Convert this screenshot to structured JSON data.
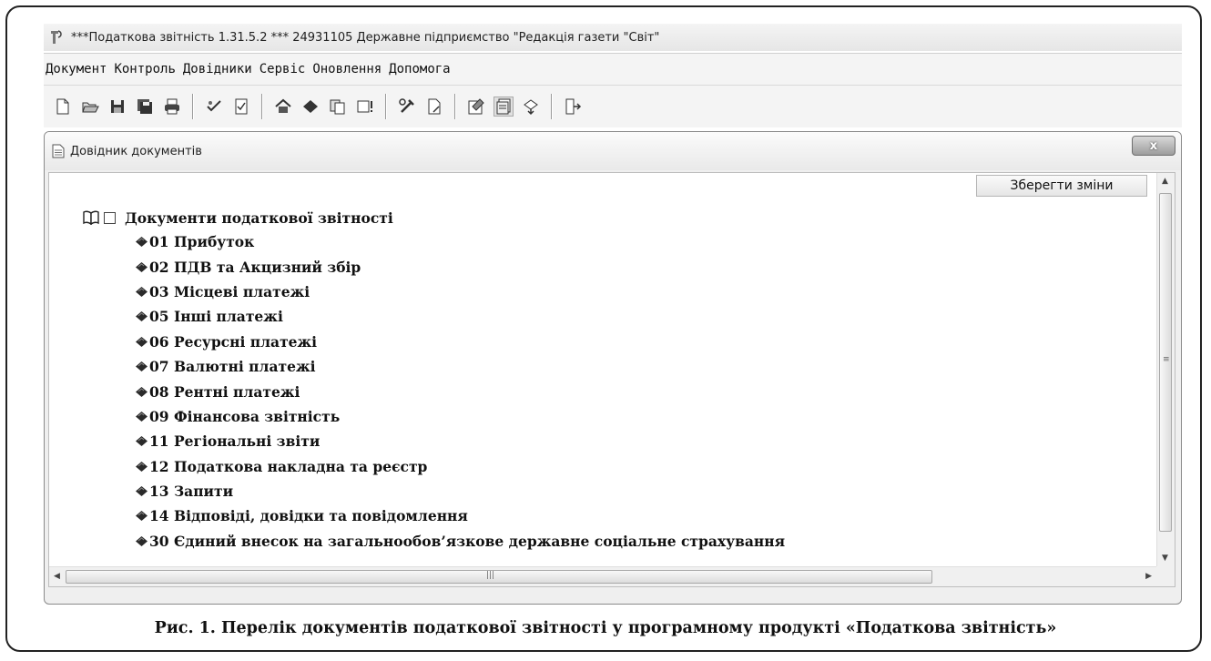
{
  "window": {
    "title": "***Податкова звітність 1.31.5.2 *** 24931105 Державне підприємство \"Редакція газети \"Світ\""
  },
  "menu": [
    "Документ",
    "Контроль",
    "Довідники",
    "Сервіс",
    "Оновлення",
    "Допомога"
  ],
  "toolbar": {
    "icons": [
      "new-icon",
      "open-icon",
      "save-icon",
      "save-all-icon",
      "print-icon",
      "check-icon",
      "report-icon",
      "home-icon",
      "pill-icon",
      "copy-icon",
      "warning-icon",
      "tools-icon",
      "document-icon",
      "properties-icon",
      "form-icon",
      "update-icon",
      "exit-icon"
    ]
  },
  "dialog": {
    "title": "Довідник документів",
    "close_label": "x",
    "save_button": "Зберегти зміни"
  },
  "tree": {
    "root": "Документи податкової звітності",
    "items": [
      "01 Прибуток",
      "02 ПДВ та Акцизний збір",
      "03 Місцеві платежі",
      "05 Інші платежі",
      "06 Ресурсні платежі",
      "07 Валютні платежі",
      "08 Рентні платежі",
      "09 Фінансова звітність",
      "11 Регіональні звіти",
      "12 Податкова накладна та реєстр",
      "13 Запити",
      "14 Відповіді, довідки та повідомлення",
      "30 Єдиний внесок на загальнообов’язкове державне соціальне страхування"
    ]
  },
  "caption": "Рис. 1. Перелік документів податкової звітності у програмному продукті «Податкова звітність»"
}
